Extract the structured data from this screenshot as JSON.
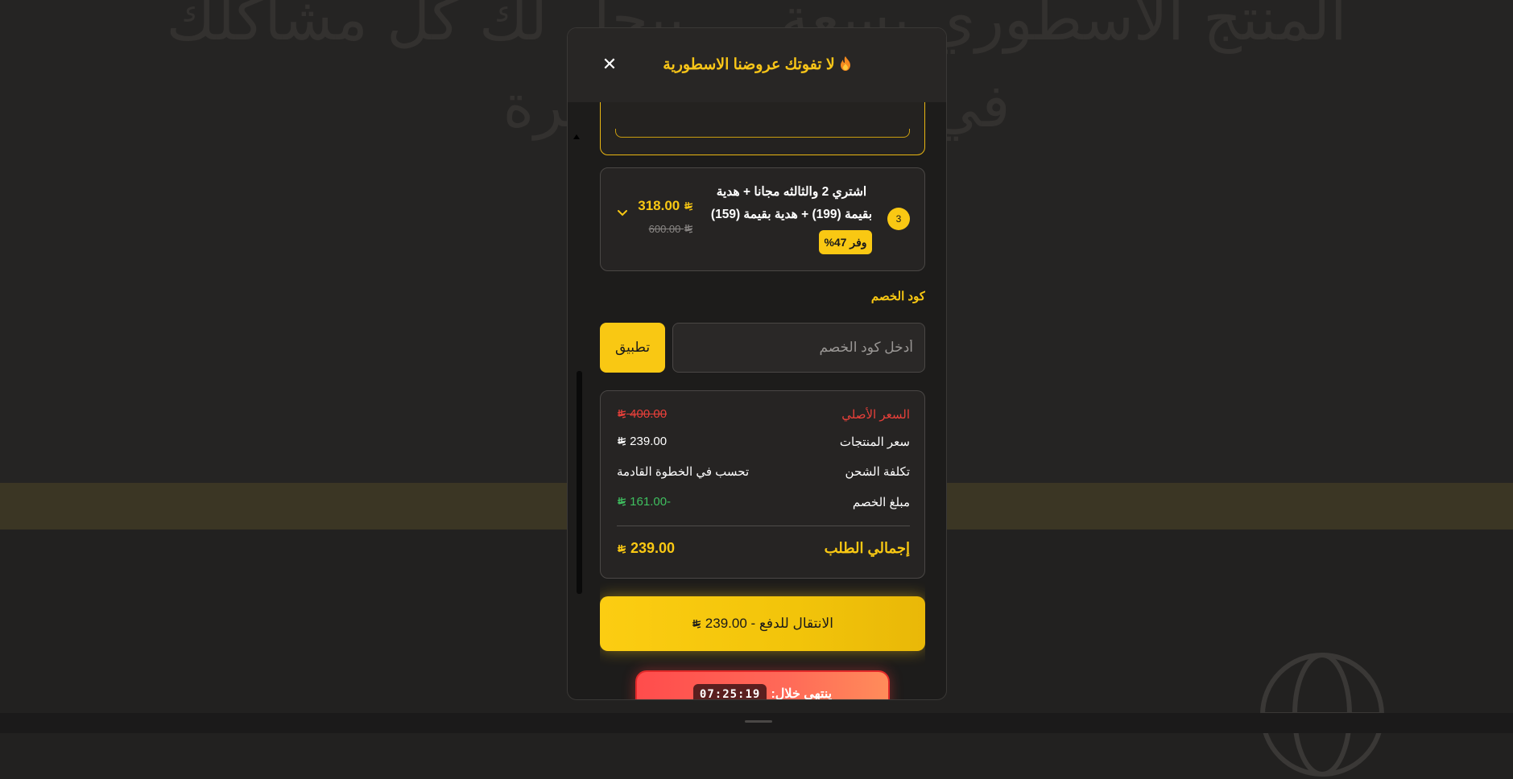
{
  "background": {
    "headline": "المنتج الاسطوري بسعة ... بيحل لك كل مشاكلك في ... ميزاته الكثيرة"
  },
  "modal": {
    "title": "لا تفوتك عروضنا الاسطورية",
    "title_icon": "fire-icon",
    "close_icon": "close-icon",
    "offer": {
      "number": "3",
      "title": "اشتري 2 والثالثه مجانا + هدية بقيمة (199) + هدية بقيمة (159)",
      "save_badge": "وفر 47%",
      "price": "318.00",
      "old_price": "600.00",
      "currency_icon": "riyal-icon"
    },
    "discount": {
      "label": "كود الخصم",
      "placeholder": "أدخل كود الخصم",
      "value": "",
      "apply_label": "تطبيق"
    },
    "summary": {
      "original_label": "السعر الأصلي",
      "original_value": "400.00",
      "products_label": "سعر المنتجات",
      "products_value": "239.00",
      "shipping_label": "تكلفة الشحن",
      "shipping_value": "تحسب في الخطوة القادمة",
      "discount_label": "مبلغ الخصم",
      "discount_value": "161.00-",
      "total_label": "إجمالي الطلب",
      "total_value": "239.00"
    },
    "checkout": {
      "label": "الانتقال للدفع - 239.00"
    },
    "countdown": {
      "label": "ينتهي خلال:",
      "time": "07:25:19"
    }
  },
  "colors": {
    "accent": "#F9C813",
    "danger": "#E8403A",
    "success": "#3FBF5F",
    "modal_bg": "#1D1C1B"
  }
}
